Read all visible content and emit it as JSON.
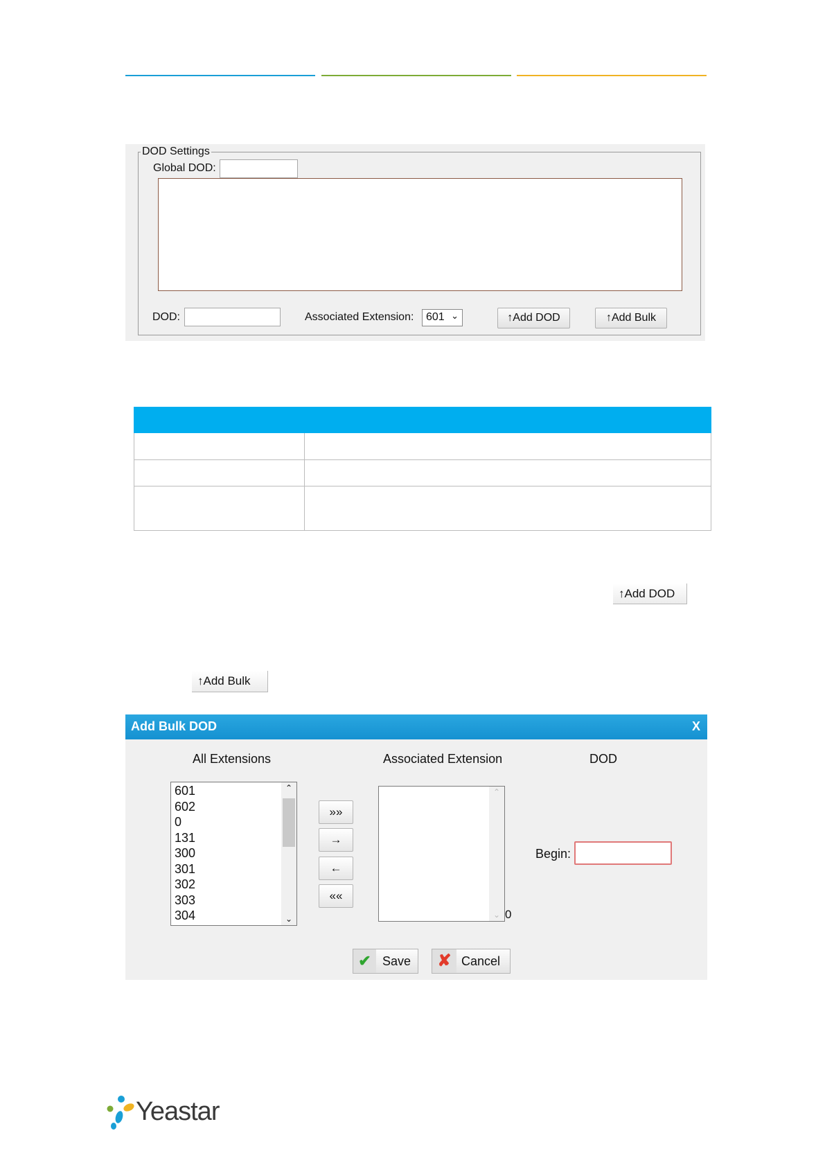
{
  "header": {
    "line_colors": [
      "#1a9fd6",
      "#7dab36",
      "#f0b323"
    ]
  },
  "dod_settings": {
    "legend": "DOD Settings",
    "global_dod_label": "Global DOD:",
    "global_dod_value": "",
    "dod_label": "DOD:",
    "dod_value": "",
    "associated_extension_label": "Associated Extension:",
    "associated_extension_value": "601",
    "add_dod_button": "↑Add DOD",
    "add_bulk_button": "↑Add Bulk"
  },
  "table": {
    "header_color": "#00aeef",
    "rows": [
      "",
      "",
      ""
    ]
  },
  "inline_buttons": {
    "add_dod": "↑Add DOD",
    "add_bulk": "↑Add Bulk"
  },
  "dialog": {
    "title": "Add Bulk DOD",
    "close": "X",
    "col_all_extensions": "All Extensions",
    "col_associated_extension": "Associated Extension",
    "col_dod": "DOD",
    "all_extensions": [
      "601",
      "602",
      "0",
      "131",
      "300",
      "301",
      "302",
      "303",
      "304"
    ],
    "move_all_right": "»»",
    "move_right": "→",
    "move_left": "←",
    "move_all_left": "««",
    "associated_count": "0",
    "begin_label": "Begin:",
    "begin_value": "",
    "save": "Save",
    "cancel": "Cancel"
  },
  "footer": {
    "brand": "Yeastar"
  }
}
